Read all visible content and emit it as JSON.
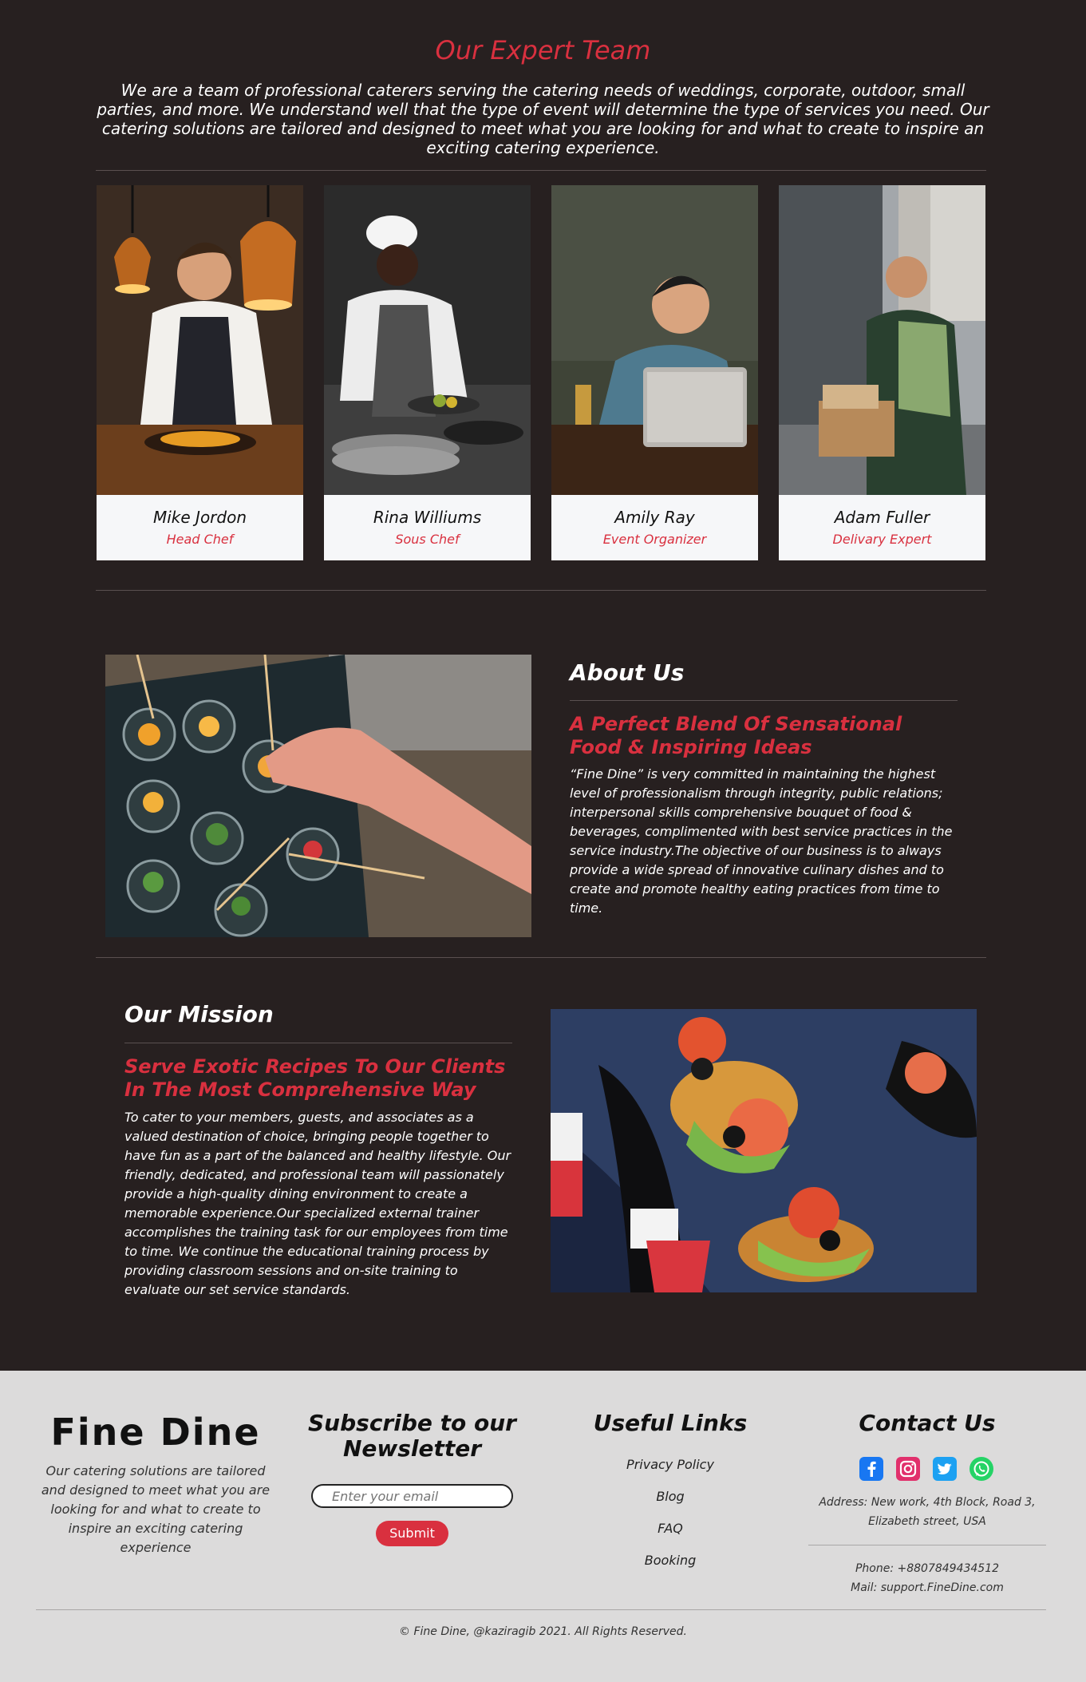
{
  "team": {
    "title": "Our Expert Team",
    "intro": "We are a team of professional caterers serving the catering needs of weddings, corporate, outdoor, small parties, and more. We understand well that the type of event will determine the type of services you need. Our catering solutions are tailored and designed to meet what you are looking for and what to create to inspire an exciting catering experience.",
    "members": [
      {
        "name": "Mike Jordon",
        "role": "Head Chef"
      },
      {
        "name": "Rina Williums",
        "role": "Sous Chef"
      },
      {
        "name": "Amily Ray",
        "role": "Event Organizer"
      },
      {
        "name": "Adam Fuller",
        "role": "Delivary Expert"
      }
    ]
  },
  "about": {
    "heading": "About Us",
    "subheading": "A Perfect Blend Of Sensational Food & Inspiring Ideas",
    "text": "“Fine Dine” is very committed in maintaining the highest level of professionalism through integrity, public relations; interpersonal skills comprehensive bouquet of food & beverages, complimented with best service practices in the service industry.The objective of our business is to always provide a wide spread of innovative culinary dishes and to create and promote healthy eating practices from time to time."
  },
  "mission": {
    "heading": "Our Mission",
    "subheading": "Serve Exotic Recipes To Our Clients In The Most Comprehensive Way",
    "text": "To cater to your members, guests, and associates as a valued destination of choice, bringing people together to have fun as a part of the balanced and healthy lifestyle. Our friendly, dedicated, and professional team will passionately provide a high-quality dining environment to create a memorable experience.Our specialized external trainer accomplishes the training task for our employees from time to time. We continue the educational training process by providing classroom sessions and on-site training to evaluate our set service standards."
  },
  "footer": {
    "brand": "Fine Dine",
    "brand_text": "Our catering solutions are tailored and designed to meet what you are looking for and what to create to inspire an exciting catering experience",
    "newsletter_heading": "Subscribe to our Newsletter",
    "email_placeholder": "Enter your email",
    "submit_label": "Submit",
    "links_heading": "Useful Links",
    "links": [
      "Privacy Policy",
      "Blog",
      "FAQ",
      "Booking"
    ],
    "contact_heading": "Contact Us",
    "social_icons": [
      "facebook-icon",
      "instagram-icon",
      "twitter-icon",
      "whatsapp-icon"
    ],
    "address": "Address: New work, 4th Block, Road 3, Elizabeth street, USA",
    "phone": "Phone: +8807849434512",
    "mail": "Mail: support.FineDine.com",
    "copyright": "© Fine Dine, @kaziragib 2021. All Rights Reserved."
  },
  "colors": {
    "background": "#272020",
    "accent": "#d9303f",
    "footer_bg": "#dcdbdb",
    "card_bg": "#f6f7f9"
  }
}
